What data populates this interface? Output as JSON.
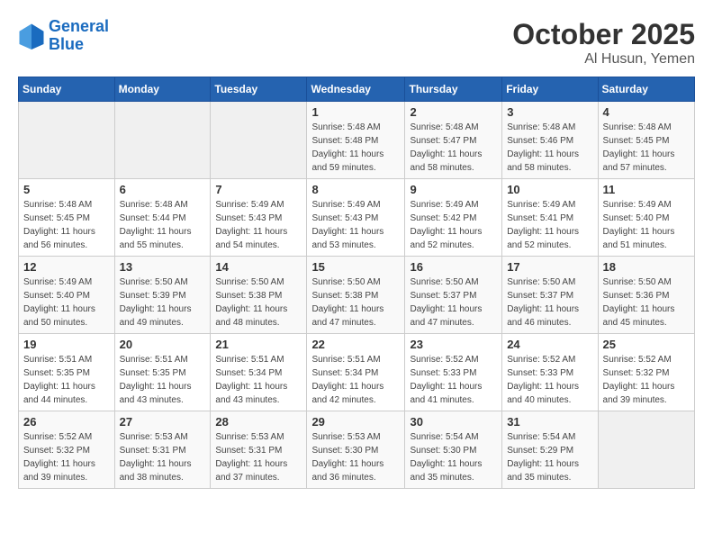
{
  "logo": {
    "line1": "General",
    "line2": "Blue"
  },
  "title": "October 2025",
  "location": "Al Husun, Yemen",
  "days_of_week": [
    "Sunday",
    "Monday",
    "Tuesday",
    "Wednesday",
    "Thursday",
    "Friday",
    "Saturday"
  ],
  "weeks": [
    [
      {
        "day": "",
        "info": ""
      },
      {
        "day": "",
        "info": ""
      },
      {
        "day": "",
        "info": ""
      },
      {
        "day": "1",
        "info": "Sunrise: 5:48 AM\nSunset: 5:48 PM\nDaylight: 11 hours\nand 59 minutes."
      },
      {
        "day": "2",
        "info": "Sunrise: 5:48 AM\nSunset: 5:47 PM\nDaylight: 11 hours\nand 58 minutes."
      },
      {
        "day": "3",
        "info": "Sunrise: 5:48 AM\nSunset: 5:46 PM\nDaylight: 11 hours\nand 58 minutes."
      },
      {
        "day": "4",
        "info": "Sunrise: 5:48 AM\nSunset: 5:45 PM\nDaylight: 11 hours\nand 57 minutes."
      }
    ],
    [
      {
        "day": "5",
        "info": "Sunrise: 5:48 AM\nSunset: 5:45 PM\nDaylight: 11 hours\nand 56 minutes."
      },
      {
        "day": "6",
        "info": "Sunrise: 5:48 AM\nSunset: 5:44 PM\nDaylight: 11 hours\nand 55 minutes."
      },
      {
        "day": "7",
        "info": "Sunrise: 5:49 AM\nSunset: 5:43 PM\nDaylight: 11 hours\nand 54 minutes."
      },
      {
        "day": "8",
        "info": "Sunrise: 5:49 AM\nSunset: 5:43 PM\nDaylight: 11 hours\nand 53 minutes."
      },
      {
        "day": "9",
        "info": "Sunrise: 5:49 AM\nSunset: 5:42 PM\nDaylight: 11 hours\nand 52 minutes."
      },
      {
        "day": "10",
        "info": "Sunrise: 5:49 AM\nSunset: 5:41 PM\nDaylight: 11 hours\nand 52 minutes."
      },
      {
        "day": "11",
        "info": "Sunrise: 5:49 AM\nSunset: 5:40 PM\nDaylight: 11 hours\nand 51 minutes."
      }
    ],
    [
      {
        "day": "12",
        "info": "Sunrise: 5:49 AM\nSunset: 5:40 PM\nDaylight: 11 hours\nand 50 minutes."
      },
      {
        "day": "13",
        "info": "Sunrise: 5:50 AM\nSunset: 5:39 PM\nDaylight: 11 hours\nand 49 minutes."
      },
      {
        "day": "14",
        "info": "Sunrise: 5:50 AM\nSunset: 5:38 PM\nDaylight: 11 hours\nand 48 minutes."
      },
      {
        "day": "15",
        "info": "Sunrise: 5:50 AM\nSunset: 5:38 PM\nDaylight: 11 hours\nand 47 minutes."
      },
      {
        "day": "16",
        "info": "Sunrise: 5:50 AM\nSunset: 5:37 PM\nDaylight: 11 hours\nand 47 minutes."
      },
      {
        "day": "17",
        "info": "Sunrise: 5:50 AM\nSunset: 5:37 PM\nDaylight: 11 hours\nand 46 minutes."
      },
      {
        "day": "18",
        "info": "Sunrise: 5:50 AM\nSunset: 5:36 PM\nDaylight: 11 hours\nand 45 minutes."
      }
    ],
    [
      {
        "day": "19",
        "info": "Sunrise: 5:51 AM\nSunset: 5:35 PM\nDaylight: 11 hours\nand 44 minutes."
      },
      {
        "day": "20",
        "info": "Sunrise: 5:51 AM\nSunset: 5:35 PM\nDaylight: 11 hours\nand 43 minutes."
      },
      {
        "day": "21",
        "info": "Sunrise: 5:51 AM\nSunset: 5:34 PM\nDaylight: 11 hours\nand 43 minutes."
      },
      {
        "day": "22",
        "info": "Sunrise: 5:51 AM\nSunset: 5:34 PM\nDaylight: 11 hours\nand 42 minutes."
      },
      {
        "day": "23",
        "info": "Sunrise: 5:52 AM\nSunset: 5:33 PM\nDaylight: 11 hours\nand 41 minutes."
      },
      {
        "day": "24",
        "info": "Sunrise: 5:52 AM\nSunset: 5:33 PM\nDaylight: 11 hours\nand 40 minutes."
      },
      {
        "day": "25",
        "info": "Sunrise: 5:52 AM\nSunset: 5:32 PM\nDaylight: 11 hours\nand 39 minutes."
      }
    ],
    [
      {
        "day": "26",
        "info": "Sunrise: 5:52 AM\nSunset: 5:32 PM\nDaylight: 11 hours\nand 39 minutes."
      },
      {
        "day": "27",
        "info": "Sunrise: 5:53 AM\nSunset: 5:31 PM\nDaylight: 11 hours\nand 38 minutes."
      },
      {
        "day": "28",
        "info": "Sunrise: 5:53 AM\nSunset: 5:31 PM\nDaylight: 11 hours\nand 37 minutes."
      },
      {
        "day": "29",
        "info": "Sunrise: 5:53 AM\nSunset: 5:30 PM\nDaylight: 11 hours\nand 36 minutes."
      },
      {
        "day": "30",
        "info": "Sunrise: 5:54 AM\nSunset: 5:30 PM\nDaylight: 11 hours\nand 35 minutes."
      },
      {
        "day": "31",
        "info": "Sunrise: 5:54 AM\nSunset: 5:29 PM\nDaylight: 11 hours\nand 35 minutes."
      },
      {
        "day": "",
        "info": ""
      }
    ]
  ]
}
